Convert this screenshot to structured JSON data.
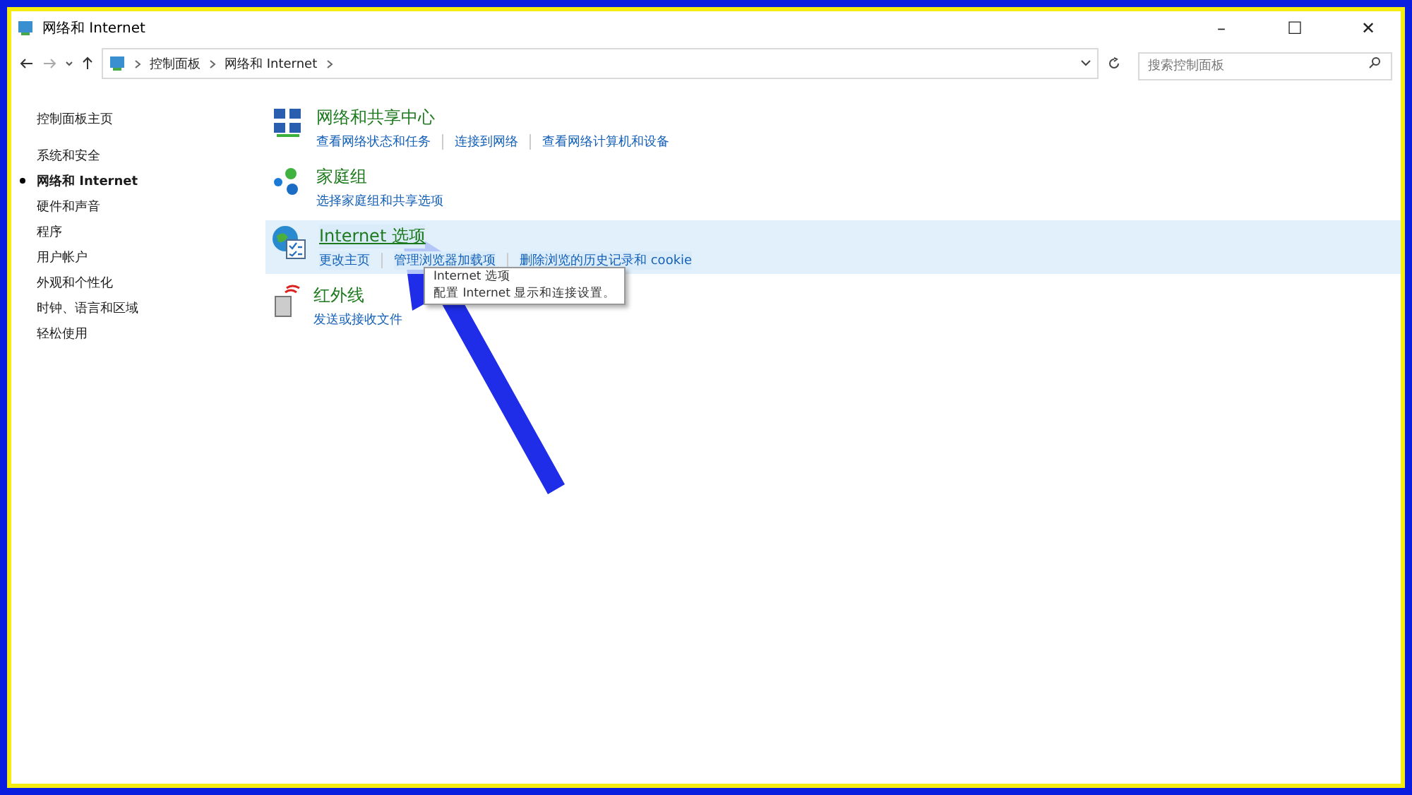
{
  "window": {
    "title": "网络和 Internet",
    "controls": [
      "–",
      "☐",
      "✕"
    ]
  },
  "address_bar": {
    "crumbs": [
      "控制面板",
      "网络和 Internet"
    ]
  },
  "search": {
    "placeholder": "搜索控制面板"
  },
  "sidebar": {
    "home": "控制面板主页",
    "items": [
      {
        "label": "系统和安全",
        "selected": false
      },
      {
        "label": "网络和 Internet",
        "selected": true
      },
      {
        "label": "硬件和声音",
        "selected": false
      },
      {
        "label": "程序",
        "selected": false
      },
      {
        "label": "用户帐户",
        "selected": false
      },
      {
        "label": "外观和个性化",
        "selected": false
      },
      {
        "label": "时钟、语言和区域",
        "selected": false
      },
      {
        "label": "轻松使用",
        "selected": false
      }
    ]
  },
  "categories": [
    {
      "kind": "network",
      "title": "网络和共享中心",
      "hovered": false,
      "links": [
        "查看网络状态和任务",
        "连接到网络",
        "查看网络计算机和设备"
      ]
    },
    {
      "kind": "homegroup",
      "title": "家庭组",
      "hovered": false,
      "links": [
        "选择家庭组和共享选项"
      ]
    },
    {
      "kind": "internet",
      "title": "Internet 选项",
      "hovered": true,
      "links": [
        "更改主页",
        "管理浏览器加载项",
        "删除浏览的历史记录和 cookie"
      ]
    },
    {
      "kind": "infrared",
      "title": "红外线",
      "hovered": false,
      "links": [
        "发送或接收文件"
      ]
    }
  ],
  "tooltip": {
    "title": "Internet 选项",
    "text": "配置 Internet 显示和连接设置。"
  }
}
